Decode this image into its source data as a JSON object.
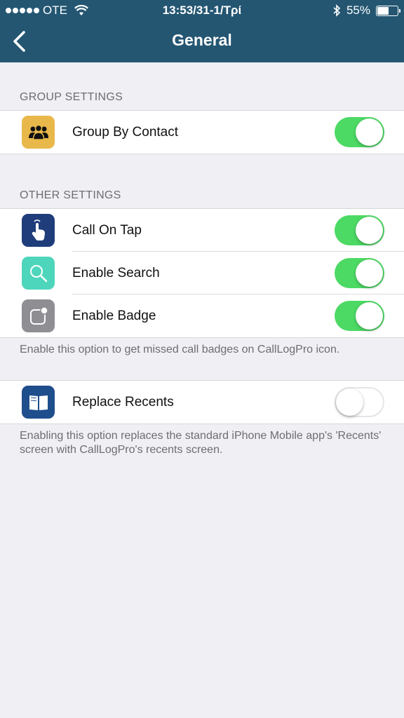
{
  "status_bar": {
    "carrier": "OTE",
    "time": "13:53/31-1/Τρί",
    "battery": "55%",
    "battery_level": 0.55
  },
  "nav": {
    "title": "General",
    "back_icon": "chevron-left-icon"
  },
  "sections": {
    "group_settings": {
      "header": "GROUP SETTINGS",
      "rows": [
        {
          "label": "Group By Contact",
          "icon": "people-icon",
          "icon_color": "#e8b84a",
          "toggle_on": true
        }
      ]
    },
    "other_settings": {
      "header": "OTHER SETTINGS",
      "rows": [
        {
          "label": "Call On Tap",
          "icon": "tap-hand-icon",
          "icon_color": "#1f3d7a",
          "toggle_on": true
        },
        {
          "label": "Enable Search",
          "icon": "search-icon",
          "icon_color": "#4ed6bc",
          "toggle_on": true
        },
        {
          "label": "Enable Badge",
          "icon": "badge-icon",
          "icon_color": "#8e8e93",
          "toggle_on": true
        }
      ],
      "footer": "Enable this option to get missed call badges on CallLogPro icon."
    },
    "recents": {
      "rows": [
        {
          "label": "Replace Recents",
          "icon": "book-icon",
          "icon_color": "#1f4e8c",
          "toggle_on": false
        }
      ],
      "footer": "Enabling this option replaces the standard iPhone Mobile app's 'Recents' screen with CallLogPro's recents screen."
    }
  },
  "colors": {
    "nav_bar": "#245672",
    "toggle_on": "#4cd964",
    "background": "#efeff4"
  }
}
